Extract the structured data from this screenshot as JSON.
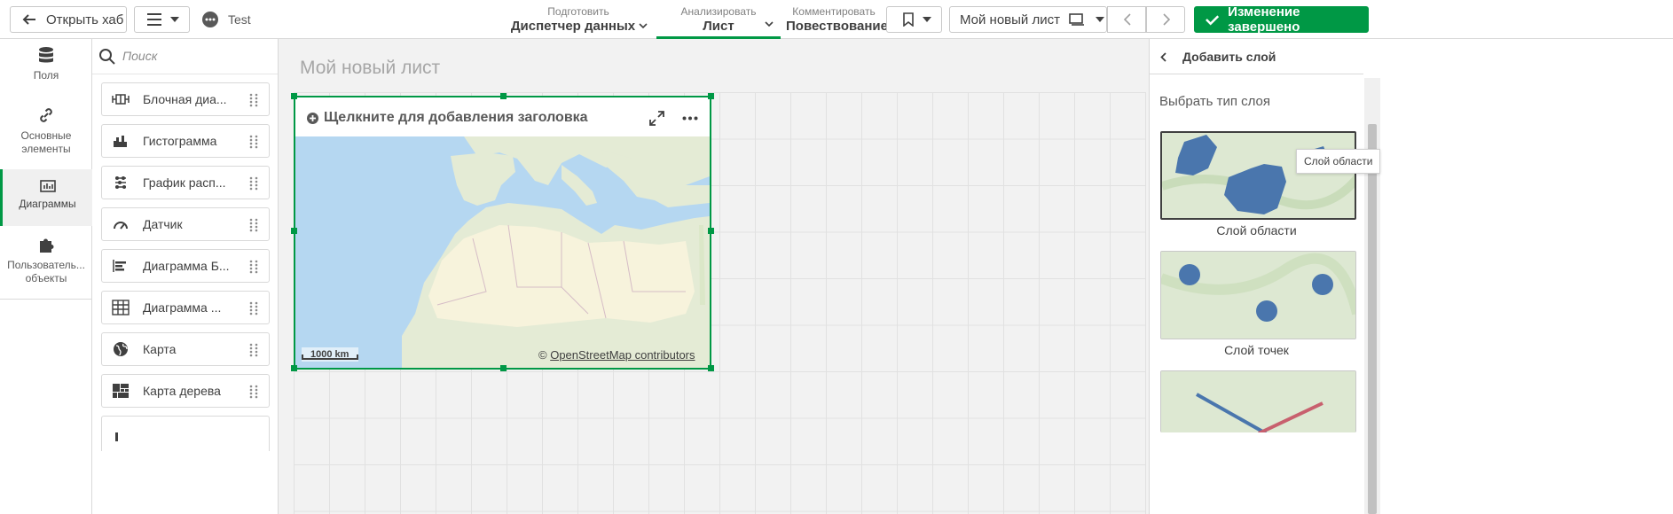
{
  "topbar": {
    "open_hub": "Открыть хаб",
    "app_name": "Test",
    "prepare": {
      "small": "Подготовить",
      "big": "Диспетчер данных"
    },
    "analyze": {
      "small": "Анализировать",
      "big": "Лист"
    },
    "narrate": {
      "small": "Комментировать",
      "big": "Повествование"
    },
    "sheet_selector": "Мой новый лист",
    "done_button": "Изменение завершено"
  },
  "rail": {
    "items": [
      {
        "label": "Поля",
        "icon": "database-icon"
      },
      {
        "label": "Основные элементы",
        "icon": "link-icon"
      },
      {
        "label": "Диаграммы",
        "icon": "chart-icon"
      },
      {
        "label": "Пользователь... объекты",
        "icon": "puzzle-icon"
      }
    ],
    "line1": "Основные",
    "line2": "элементы",
    "custom1": "Пользователь...",
    "custom2": "объекты"
  },
  "assets": {
    "search_placeholder": "Поиск",
    "items": [
      {
        "label": "Блочная диа...",
        "icon": "boxplot-icon"
      },
      {
        "label": "Гистограмма",
        "icon": "histogram-icon"
      },
      {
        "label": "График расп...",
        "icon": "distribution-icon"
      },
      {
        "label": "Датчик",
        "icon": "gauge-icon"
      },
      {
        "label": "Диаграмма Б...",
        "icon": "bullet-icon"
      },
      {
        "label": "Диаграмма ...",
        "icon": "table-icon"
      },
      {
        "label": "Карта",
        "icon": "globe-icon"
      },
      {
        "label": "Карта дерева",
        "icon": "treemap-icon"
      }
    ]
  },
  "canvas": {
    "sheet_title": "Мой новый лист",
    "object_title": "Щелкните для добавления заголовка",
    "scale": "1000 km",
    "attribution_prefix": "© ",
    "attribution_link": "OpenStreetMap contributors"
  },
  "right_panel": {
    "header": "Добавить слой",
    "section": "Выбрать тип слоя",
    "layers": [
      {
        "label": "Слой области"
      },
      {
        "label": "Слой точек"
      }
    ],
    "tooltip": "Слой области"
  },
  "colors": {
    "accent": "#009845",
    "water": "#b5d7f1",
    "land": "#e4ebd5",
    "desert": "#f7f3dc",
    "area_fill": "#4a76ad",
    "line_red": "#c8606e"
  }
}
